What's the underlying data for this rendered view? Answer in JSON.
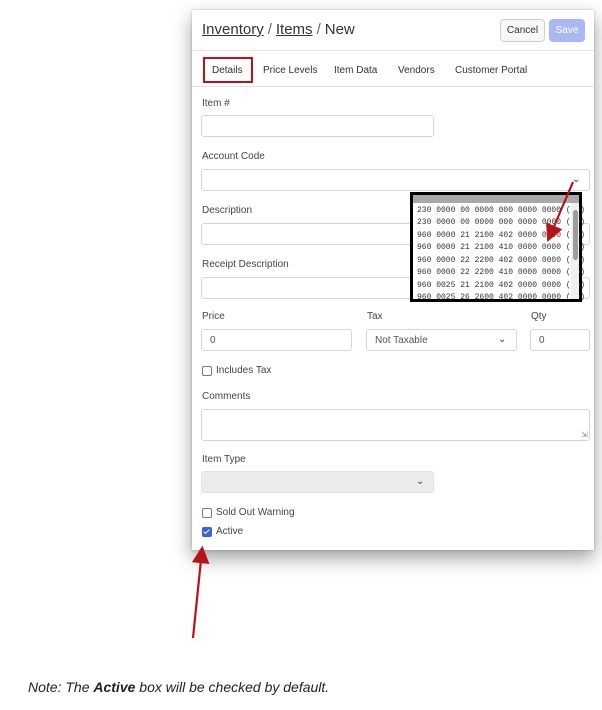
{
  "breadcrumb": {
    "root": "Inventory",
    "section": "Items",
    "current": "New",
    "separator": "/"
  },
  "buttons": {
    "cancel": "Cancel",
    "save": "Save"
  },
  "tabs": [
    {
      "label": "Details",
      "active": true
    },
    {
      "label": "Price Levels"
    },
    {
      "label": "Item Data"
    },
    {
      "label": "Vendors"
    },
    {
      "label": "Customer Portal"
    }
  ],
  "form": {
    "item_number_label": "Item #",
    "item_number_value": "",
    "account_code_label": "Account Code",
    "description_label": "Description",
    "receipt_description_label": "Receipt Description",
    "price_label": "Price",
    "price_value": "0",
    "tax_label": "Tax",
    "tax_value": "Not Taxable",
    "qty_label": "Qty",
    "qty_value": "0",
    "includes_tax_label": "Includes Tax",
    "comments_label": "Comments",
    "item_type_label": "Item Type",
    "sold_out_warning_label": "Sold Out Warning",
    "active_label": "Active",
    "active_checked": true,
    "includes_tax_checked": false,
    "sold_out_warning_checked": false
  },
  "account_code_options": [
    "230 0000 00 0000 000 0000 0000 (10)",
    "230 0000 00 0000 000 0000 0000 (10)",
    "960 0000 21 2100 402 0000 0000 (10)",
    "960 0000 21 2100 410 0000 0000 (10)",
    "960 0000 22 2200 402 0000 0000 (10)",
    "960 0000 22 2200 410 0000 0000 (10)",
    "960 0025 21 2100 402 0000 0000 (10)",
    "960 0025 26 2600 402 0000 0000 (10)"
  ],
  "note": {
    "prefix": "Note: The ",
    "emphasis": "Active",
    "suffix": " box will be checked by default."
  },
  "colors": {
    "highlight": "#b8121b",
    "save_button": "#a9b8f3",
    "checkbox_checked": "#3a63d8"
  }
}
